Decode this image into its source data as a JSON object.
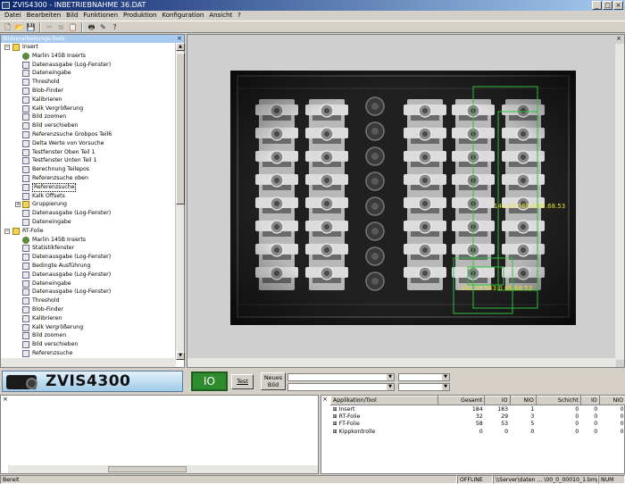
{
  "window": {
    "title": "ZVIS4300 - INBETRIEBNAHME 36.DAT",
    "buttons": [
      "_",
      "□",
      "×"
    ]
  },
  "menu": [
    "Datei",
    "Bearbeiten",
    "Bild",
    "Funktionen",
    "Produktion",
    "Konfiguration",
    "Ansicht",
    "?"
  ],
  "toolbar": {
    "icons": [
      "new-icon",
      "open-icon",
      "save-icon",
      "cut-icon",
      "copy-icon",
      "paste-icon",
      "print-icon",
      "tool-icon",
      "help-icon"
    ]
  },
  "tree": {
    "title": "Bildverarbeitungs-Tools",
    "nodes": [
      {
        "label": "Insert",
        "level": 0,
        "type": "folder",
        "toggle": "−"
      },
      {
        "label": "Marlin 145B Inserts",
        "level": 1,
        "type": "cam"
      },
      {
        "label": "Datenausgabe (Log-Fenster)",
        "level": 1,
        "type": "tool"
      },
      {
        "label": "Dateneingabe",
        "level": 1,
        "type": "tool"
      },
      {
        "label": "Threshold",
        "level": 1,
        "type": "tool"
      },
      {
        "label": "Blob-Finder",
        "level": 1,
        "type": "tool"
      },
      {
        "label": "Kalibrieren",
        "level": 1,
        "type": "tool"
      },
      {
        "label": "Kalk Vergrößerung",
        "level": 1,
        "type": "tool"
      },
      {
        "label": "Bild zoomen",
        "level": 1,
        "type": "tool"
      },
      {
        "label": "Bild verschieben",
        "level": 1,
        "type": "tool"
      },
      {
        "label": "Referenzsuche Grobpos Teil6",
        "level": 1,
        "type": "tool"
      },
      {
        "label": "Delta Werte von Vorsuche",
        "level": 1,
        "type": "tool"
      },
      {
        "label": "Testfenster Oben Teil 1",
        "level": 1,
        "type": "tool"
      },
      {
        "label": "Testfenster Unten Teil 1",
        "level": 1,
        "type": "tool"
      },
      {
        "label": "Berechnung Teilepos",
        "level": 1,
        "type": "tool"
      },
      {
        "label": "Referenzsuche oben",
        "level": 1,
        "type": "tool"
      },
      {
        "label": "Referenzsuche",
        "level": 1,
        "type": "tool",
        "selected": true
      },
      {
        "label": "Kalk Offsets",
        "level": 1,
        "type": "tool"
      },
      {
        "label": "Gruppierung",
        "level": 1,
        "type": "folder",
        "toggle": "+"
      },
      {
        "label": "Datenausgabe (Log-Fenster)",
        "level": 1,
        "type": "tool"
      },
      {
        "label": "Dateneingabe",
        "level": 1,
        "type": "tool"
      },
      {
        "label": "RT-Folie",
        "level": 0,
        "type": "folder",
        "toggle": "−"
      },
      {
        "label": "Marlin 145B Inserts",
        "level": 1,
        "type": "cam"
      },
      {
        "label": "Statistikfenster",
        "level": 1,
        "type": "tool"
      },
      {
        "label": "Datenausgabe (Log-Fenster)",
        "level": 1,
        "type": "tool"
      },
      {
        "label": "Bedingte Ausführung",
        "level": 1,
        "type": "tool"
      },
      {
        "label": "Datenausgabe (Log-Fenster)",
        "level": 1,
        "type": "tool"
      },
      {
        "label": "Dateneingabe",
        "level": 1,
        "type": "tool"
      },
      {
        "label": "Datenausgabe (Log-Fenster)",
        "level": 1,
        "type": "tool"
      },
      {
        "label": "Threshold",
        "level": 1,
        "type": "tool"
      },
      {
        "label": "Blob-Finder",
        "level": 1,
        "type": "tool"
      },
      {
        "label": "Kalibrieren",
        "level": 1,
        "type": "tool"
      },
      {
        "label": "Kalk Vergrößerung",
        "level": 1,
        "type": "tool"
      },
      {
        "label": "Bild zoomen",
        "level": 1,
        "type": "tool"
      },
      {
        "label": "Bild verschieben",
        "level": 1,
        "type": "tool"
      },
      {
        "label": "Referenzsuche",
        "level": 1,
        "type": "tool"
      },
      {
        "label": "Kalk Offsets",
        "level": 1,
        "type": "tool"
      }
    ]
  },
  "image": {
    "overlay_text_1": "141.15 563.0 65.68.53",
    "overlay_text_2": "141.15 563.0 65.68.53",
    "overlay_color": "#e8e020",
    "roi_color": "#2fbf3f"
  },
  "controls": {
    "logo_text": "ZVIS4300",
    "io_status": "IO",
    "io_color": "#2e8b2e",
    "test_button": "Test",
    "new_image_button_line1": "Neues",
    "new_image_button_line2": "Bild",
    "combo1_value": "",
    "combo2_value": "",
    "combo3_value": "",
    "combo4_value": ""
  },
  "stats": {
    "columns": [
      "Applikation/Tool",
      "Gesamt",
      "IO",
      "NIO",
      "Schicht",
      "IO",
      "NIO"
    ],
    "rows": [
      {
        "name": "Insert",
        "vals": [
          "184",
          "183",
          "1",
          "0",
          "0",
          "0"
        ]
      },
      {
        "name": "RT-Folie",
        "vals": [
          "32",
          "29",
          "3",
          "0",
          "0",
          "0"
        ]
      },
      {
        "name": "FT-Folie",
        "vals": [
          "58",
          "53",
          "5",
          "0",
          "0",
          "0"
        ]
      },
      {
        "name": "Kippkontrolle",
        "vals": [
          "0",
          "0",
          "0",
          "0",
          "0",
          "0"
        ]
      }
    ]
  },
  "status": {
    "ready": "Bereit",
    "mode": "OFFLINE",
    "file": "\\\\Server\\daten ... \\00_0_00010_1.bmp",
    "num": "NUM"
  }
}
